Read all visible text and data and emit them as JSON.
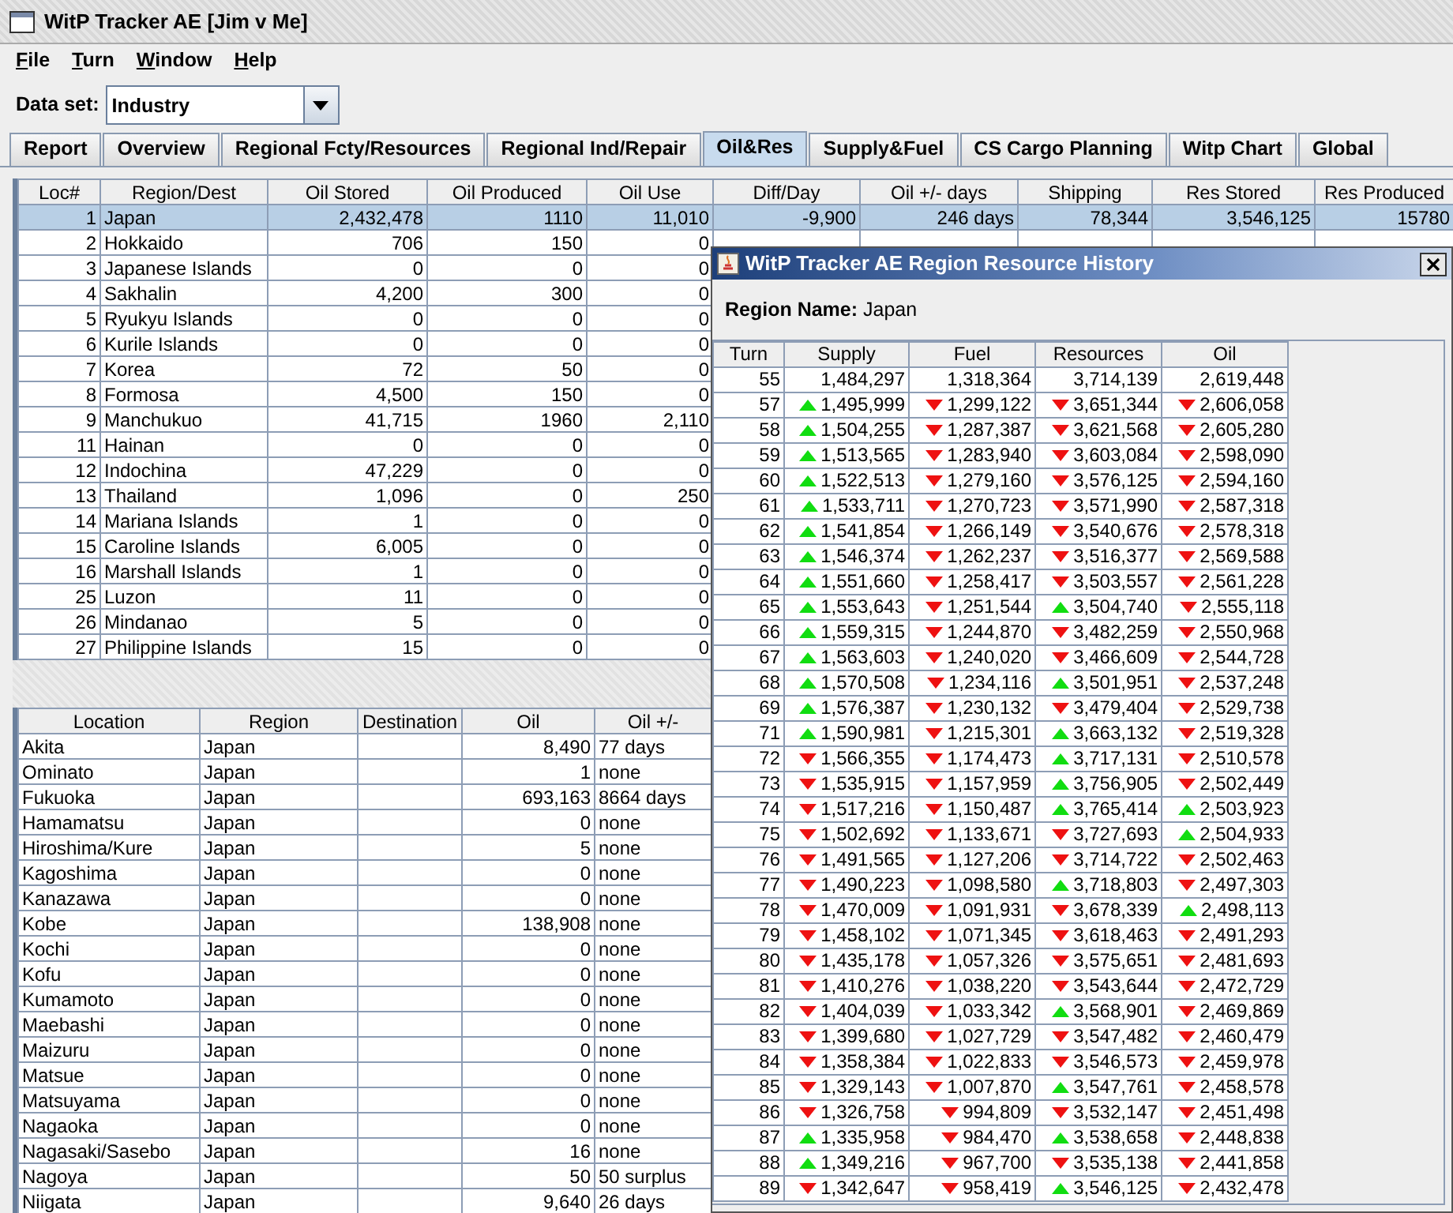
{
  "window": {
    "title": "WitP Tracker AE [Jim v Me]"
  },
  "menu": [
    "File",
    "Turn",
    "Window",
    "Help"
  ],
  "data_set": {
    "label": "Data set:",
    "value": "Industry"
  },
  "tabs": [
    {
      "label": "Report",
      "selected": false
    },
    {
      "label": "Overview",
      "selected": false
    },
    {
      "label": "Regional Fcty/Resources",
      "selected": false
    },
    {
      "label": "Regional Ind/Repair",
      "selected": false
    },
    {
      "label": "Oil&Res",
      "selected": true
    },
    {
      "label": "Supply&Fuel",
      "selected": false
    },
    {
      "label": "CS Cargo Planning",
      "selected": false
    },
    {
      "label": "Witp Chart",
      "selected": false
    },
    {
      "label": "Global",
      "selected": false
    }
  ],
  "region_table": {
    "columns": [
      "Loc#",
      "Region/Dest",
      "Oil Stored",
      "Oil Produced",
      "Oil Use",
      "Diff/Day",
      "Oil +/- days",
      "Shipping",
      "Res Stored",
      "Res Produced"
    ],
    "rows": [
      {
        "cells": [
          "1",
          "Japan",
          "2,432,478",
          "1110",
          "11,010",
          "-9,900",
          "246 days",
          "78,344",
          "3,546,125",
          "15780"
        ],
        "selected": true
      },
      {
        "cells": [
          "2",
          "Hokkaido",
          "706",
          "150",
          "0"
        ],
        "selected": false
      },
      {
        "cells": [
          "3",
          "Japanese Islands",
          "0",
          "0",
          "0"
        ],
        "selected": false
      },
      {
        "cells": [
          "4",
          "Sakhalin",
          "4,200",
          "300",
          "0"
        ],
        "selected": false
      },
      {
        "cells": [
          "5",
          "Ryukyu Islands",
          "0",
          "0",
          "0"
        ],
        "selected": false
      },
      {
        "cells": [
          "6",
          "Kurile Islands",
          "0",
          "0",
          "0"
        ],
        "selected": false
      },
      {
        "cells": [
          "7",
          "Korea",
          "72",
          "50",
          "0"
        ],
        "selected": false
      },
      {
        "cells": [
          "8",
          "Formosa",
          "4,500",
          "150",
          "0"
        ],
        "selected": false
      },
      {
        "cells": [
          "9",
          "Manchukuo",
          "41,715",
          "1960",
          "2,110"
        ],
        "selected": false
      },
      {
        "cells": [
          "11",
          "Hainan",
          "0",
          "0",
          "0"
        ],
        "selected": false
      },
      {
        "cells": [
          "12",
          "Indochina",
          "47,229",
          "0",
          "0"
        ],
        "selected": false
      },
      {
        "cells": [
          "13",
          "Thailand",
          "1,096",
          "0",
          "250"
        ],
        "selected": false
      },
      {
        "cells": [
          "14",
          "Mariana Islands",
          "1",
          "0",
          "0"
        ],
        "selected": false
      },
      {
        "cells": [
          "15",
          "Caroline Islands",
          "6,005",
          "0",
          "0"
        ],
        "selected": false
      },
      {
        "cells": [
          "16",
          "Marshall Islands",
          "1",
          "0",
          "0"
        ],
        "selected": false
      },
      {
        "cells": [
          "25",
          "Luzon",
          "11",
          "0",
          "0"
        ],
        "selected": false
      },
      {
        "cells": [
          "26",
          "Mindanao",
          "5",
          "0",
          "0"
        ],
        "selected": false
      },
      {
        "cells": [
          "27",
          "Philippine Islands",
          "15",
          "0",
          "0"
        ],
        "selected": false
      }
    ]
  },
  "location_table": {
    "columns": [
      "Location",
      "Region",
      "Destination",
      "Oil",
      "Oil +/-"
    ],
    "rows": [
      {
        "location": "Akita",
        "region": "Japan",
        "oil": "8,490",
        "oil_days": "77 days"
      },
      {
        "location": "Ominato",
        "region": "Japan",
        "oil": "1",
        "oil_days": "none"
      },
      {
        "location": "Fukuoka",
        "region": "Japan",
        "oil": "693,163",
        "oil_days": "8664 days"
      },
      {
        "location": "Hamamatsu",
        "region": "Japan",
        "oil": "0",
        "oil_days": "none"
      },
      {
        "location": "Hiroshima/Kure",
        "region": "Japan",
        "oil": "5",
        "oil_days": "none"
      },
      {
        "location": "Kagoshima",
        "region": "Japan",
        "oil": "0",
        "oil_days": "none"
      },
      {
        "location": "Kanazawa",
        "region": "Japan",
        "oil": "0",
        "oil_days": "none"
      },
      {
        "location": "Kobe",
        "region": "Japan",
        "oil": "138,908",
        "oil_days": "none"
      },
      {
        "location": "Kochi",
        "region": "Japan",
        "oil": "0",
        "oil_days": "none"
      },
      {
        "location": "Kofu",
        "region": "Japan",
        "oil": "0",
        "oil_days": "none"
      },
      {
        "location": "Kumamoto",
        "region": "Japan",
        "oil": "0",
        "oil_days": "none"
      },
      {
        "location": "Maebashi",
        "region": "Japan",
        "oil": "0",
        "oil_days": "none"
      },
      {
        "location": "Maizuru",
        "region": "Japan",
        "oil": "0",
        "oil_days": "none"
      },
      {
        "location": "Matsue",
        "region": "Japan",
        "oil": "0",
        "oil_days": "none"
      },
      {
        "location": "Matsuyama",
        "region": "Japan",
        "oil": "0",
        "oil_days": "none"
      },
      {
        "location": "Nagaoka",
        "region": "Japan",
        "oil": "0",
        "oil_days": "none"
      },
      {
        "location": "Nagasaki/Sasebo",
        "region": "Japan",
        "oil": "16",
        "oil_days": "none"
      },
      {
        "location": "Nagoya",
        "region": "Japan",
        "oil": "50",
        "oil_days": "50 surplus"
      },
      {
        "location": "Niigata",
        "region": "Japan",
        "oil": "9,640",
        "oil_days": "26 days"
      }
    ]
  },
  "history_window": {
    "title": "WitP Tracker AE Region Resource History",
    "region_label": "Region Name:",
    "region_value": "Japan",
    "columns": [
      "Turn",
      "Supply",
      "Fuel",
      "Resources",
      "Oil"
    ],
    "rows": [
      {
        "cells": [
          {
            "value": "55"
          },
          {
            "value": "1,484,297"
          },
          {
            "value": "1,318,364"
          },
          {
            "value": "3,714,139"
          },
          {
            "value": "2,619,448"
          }
        ]
      },
      {
        "cells": [
          {
            "value": "57"
          },
          {
            "value": "1,495,999",
            "rising": true
          },
          {
            "value": "1,299,122",
            "rising": false
          },
          {
            "value": "3,651,344",
            "rising": false
          },
          {
            "value": "2,606,058",
            "rising": false
          }
        ]
      },
      {
        "cells": [
          {
            "value": "58"
          },
          {
            "value": "1,504,255",
            "rising": true
          },
          {
            "value": "1,287,387",
            "rising": false
          },
          {
            "value": "3,621,568",
            "rising": false
          },
          {
            "value": "2,605,280",
            "rising": false
          }
        ]
      },
      {
        "cells": [
          {
            "value": "59"
          },
          {
            "value": "1,513,565",
            "rising": true
          },
          {
            "value": "1,283,940",
            "rising": false
          },
          {
            "value": "3,603,084",
            "rising": false
          },
          {
            "value": "2,598,090",
            "rising": false
          }
        ]
      },
      {
        "cells": [
          {
            "value": "60"
          },
          {
            "value": "1,522,513",
            "rising": true
          },
          {
            "value": "1,279,160",
            "rising": false
          },
          {
            "value": "3,576,125",
            "rising": false
          },
          {
            "value": "2,594,160",
            "rising": false
          }
        ]
      },
      {
        "cells": [
          {
            "value": "61"
          },
          {
            "value": "1,533,711",
            "rising": true
          },
          {
            "value": "1,270,723",
            "rising": false
          },
          {
            "value": "3,571,990",
            "rising": false
          },
          {
            "value": "2,587,318",
            "rising": false
          }
        ]
      },
      {
        "cells": [
          {
            "value": "62"
          },
          {
            "value": "1,541,854",
            "rising": true
          },
          {
            "value": "1,266,149",
            "rising": false
          },
          {
            "value": "3,540,676",
            "rising": false
          },
          {
            "value": "2,578,318",
            "rising": false
          }
        ]
      },
      {
        "cells": [
          {
            "value": "63"
          },
          {
            "value": "1,546,374",
            "rising": true
          },
          {
            "value": "1,262,237",
            "rising": false
          },
          {
            "value": "3,516,377",
            "rising": false
          },
          {
            "value": "2,569,588",
            "rising": false
          }
        ]
      },
      {
        "cells": [
          {
            "value": "64"
          },
          {
            "value": "1,551,660",
            "rising": true
          },
          {
            "value": "1,258,417",
            "rising": false
          },
          {
            "value": "3,503,557",
            "rising": false
          },
          {
            "value": "2,561,228",
            "rising": false
          }
        ]
      },
      {
        "cells": [
          {
            "value": "65"
          },
          {
            "value": "1,553,643",
            "rising": true
          },
          {
            "value": "1,251,544",
            "rising": false
          },
          {
            "value": "3,504,740",
            "rising": true
          },
          {
            "value": "2,555,118",
            "rising": false
          }
        ]
      },
      {
        "cells": [
          {
            "value": "66"
          },
          {
            "value": "1,559,315",
            "rising": true
          },
          {
            "value": "1,244,870",
            "rising": false
          },
          {
            "value": "3,482,259",
            "rising": false
          },
          {
            "value": "2,550,968",
            "rising": false
          }
        ]
      },
      {
        "cells": [
          {
            "value": "67"
          },
          {
            "value": "1,563,603",
            "rising": true
          },
          {
            "value": "1,240,020",
            "rising": false
          },
          {
            "value": "3,466,609",
            "rising": false
          },
          {
            "value": "2,544,728",
            "rising": false
          }
        ]
      },
      {
        "cells": [
          {
            "value": "68"
          },
          {
            "value": "1,570,508",
            "rising": true
          },
          {
            "value": "1,234,116",
            "rising": false
          },
          {
            "value": "3,501,951",
            "rising": true
          },
          {
            "value": "2,537,248",
            "rising": false
          }
        ]
      },
      {
        "cells": [
          {
            "value": "69"
          },
          {
            "value": "1,576,387",
            "rising": true
          },
          {
            "value": "1,230,132",
            "rising": false
          },
          {
            "value": "3,479,404",
            "rising": false
          },
          {
            "value": "2,529,738",
            "rising": false
          }
        ]
      },
      {
        "cells": [
          {
            "value": "71"
          },
          {
            "value": "1,590,981",
            "rising": true
          },
          {
            "value": "1,215,301",
            "rising": false
          },
          {
            "value": "3,663,132",
            "rising": true
          },
          {
            "value": "2,519,328",
            "rising": false
          }
        ]
      },
      {
        "cells": [
          {
            "value": "72"
          },
          {
            "value": "1,566,355",
            "rising": false
          },
          {
            "value": "1,174,473",
            "rising": false
          },
          {
            "value": "3,717,131",
            "rising": true
          },
          {
            "value": "2,510,578",
            "rising": false
          }
        ]
      },
      {
        "cells": [
          {
            "value": "73"
          },
          {
            "value": "1,535,915",
            "rising": false
          },
          {
            "value": "1,157,959",
            "rising": false
          },
          {
            "value": "3,756,905",
            "rising": true
          },
          {
            "value": "2,502,449",
            "rising": false
          }
        ]
      },
      {
        "cells": [
          {
            "value": "74"
          },
          {
            "value": "1,517,216",
            "rising": false
          },
          {
            "value": "1,150,487",
            "rising": false
          },
          {
            "value": "3,765,414",
            "rising": true
          },
          {
            "value": "2,503,923",
            "rising": true
          }
        ]
      },
      {
        "cells": [
          {
            "value": "75"
          },
          {
            "value": "1,502,692",
            "rising": false
          },
          {
            "value": "1,133,671",
            "rising": false
          },
          {
            "value": "3,727,693",
            "rising": false
          },
          {
            "value": "2,504,933",
            "rising": true
          }
        ]
      },
      {
        "cells": [
          {
            "value": "76"
          },
          {
            "value": "1,491,565",
            "rising": false
          },
          {
            "value": "1,127,206",
            "rising": false
          },
          {
            "value": "3,714,722",
            "rising": false
          },
          {
            "value": "2,502,463",
            "rising": false
          }
        ]
      },
      {
        "cells": [
          {
            "value": "77"
          },
          {
            "value": "1,490,223",
            "rising": false
          },
          {
            "value": "1,098,580",
            "rising": false
          },
          {
            "value": "3,718,803",
            "rising": true
          },
          {
            "value": "2,497,303",
            "rising": false
          }
        ]
      },
      {
        "cells": [
          {
            "value": "78"
          },
          {
            "value": "1,470,009",
            "rising": false
          },
          {
            "value": "1,091,931",
            "rising": false
          },
          {
            "value": "3,678,339",
            "rising": false
          },
          {
            "value": "2,498,113",
            "rising": true
          }
        ]
      },
      {
        "cells": [
          {
            "value": "79"
          },
          {
            "value": "1,458,102",
            "rising": false
          },
          {
            "value": "1,071,345",
            "rising": false
          },
          {
            "value": "3,618,463",
            "rising": false
          },
          {
            "value": "2,491,293",
            "rising": false
          }
        ]
      },
      {
        "cells": [
          {
            "value": "80"
          },
          {
            "value": "1,435,178",
            "rising": false
          },
          {
            "value": "1,057,326",
            "rising": false
          },
          {
            "value": "3,575,651",
            "rising": false
          },
          {
            "value": "2,481,693",
            "rising": false
          }
        ]
      },
      {
        "cells": [
          {
            "value": "81"
          },
          {
            "value": "1,410,276",
            "rising": false
          },
          {
            "value": "1,038,220",
            "rising": false
          },
          {
            "value": "3,543,644",
            "rising": false
          },
          {
            "value": "2,472,729",
            "rising": false
          }
        ]
      },
      {
        "cells": [
          {
            "value": "82"
          },
          {
            "value": "1,404,039",
            "rising": false
          },
          {
            "value": "1,033,342",
            "rising": false
          },
          {
            "value": "3,568,901",
            "rising": true
          },
          {
            "value": "2,469,869",
            "rising": false
          }
        ]
      },
      {
        "cells": [
          {
            "value": "83"
          },
          {
            "value": "1,399,680",
            "rising": false
          },
          {
            "value": "1,027,729",
            "rising": false
          },
          {
            "value": "3,547,482",
            "rising": false
          },
          {
            "value": "2,460,479",
            "rising": false
          }
        ]
      },
      {
        "cells": [
          {
            "value": "84"
          },
          {
            "value": "1,358,384",
            "rising": false
          },
          {
            "value": "1,022,833",
            "rising": false
          },
          {
            "value": "3,546,573",
            "rising": false
          },
          {
            "value": "2,459,978",
            "rising": false
          }
        ]
      },
      {
        "cells": [
          {
            "value": "85"
          },
          {
            "value": "1,329,143",
            "rising": false
          },
          {
            "value": "1,007,870",
            "rising": false
          },
          {
            "value": "3,547,761",
            "rising": true
          },
          {
            "value": "2,458,578",
            "rising": false
          }
        ]
      },
      {
        "cells": [
          {
            "value": "86"
          },
          {
            "value": "1,326,758",
            "rising": false
          },
          {
            "value": "994,809",
            "rising": false
          },
          {
            "value": "3,532,147",
            "rising": false
          },
          {
            "value": "2,451,498",
            "rising": false
          }
        ]
      },
      {
        "cells": [
          {
            "value": "87"
          },
          {
            "value": "1,335,958",
            "rising": true
          },
          {
            "value": "984,470",
            "rising": false
          },
          {
            "value": "3,538,658",
            "rising": true
          },
          {
            "value": "2,448,838",
            "rising": false
          }
        ]
      },
      {
        "cells": [
          {
            "value": "88"
          },
          {
            "value": "1,349,216",
            "rising": true
          },
          {
            "value": "967,700",
            "rising": false
          },
          {
            "value": "3,535,138",
            "rising": false
          },
          {
            "value": "2,441,858",
            "rising": false
          }
        ]
      },
      {
        "cells": [
          {
            "value": "89"
          },
          {
            "value": "1,342,647",
            "rising": false
          },
          {
            "value": "958,419",
            "rising": false
          },
          {
            "value": "3,546,125",
            "rising": true
          },
          {
            "value": "2,432,478",
            "rising": false
          }
        ]
      }
    ]
  }
}
